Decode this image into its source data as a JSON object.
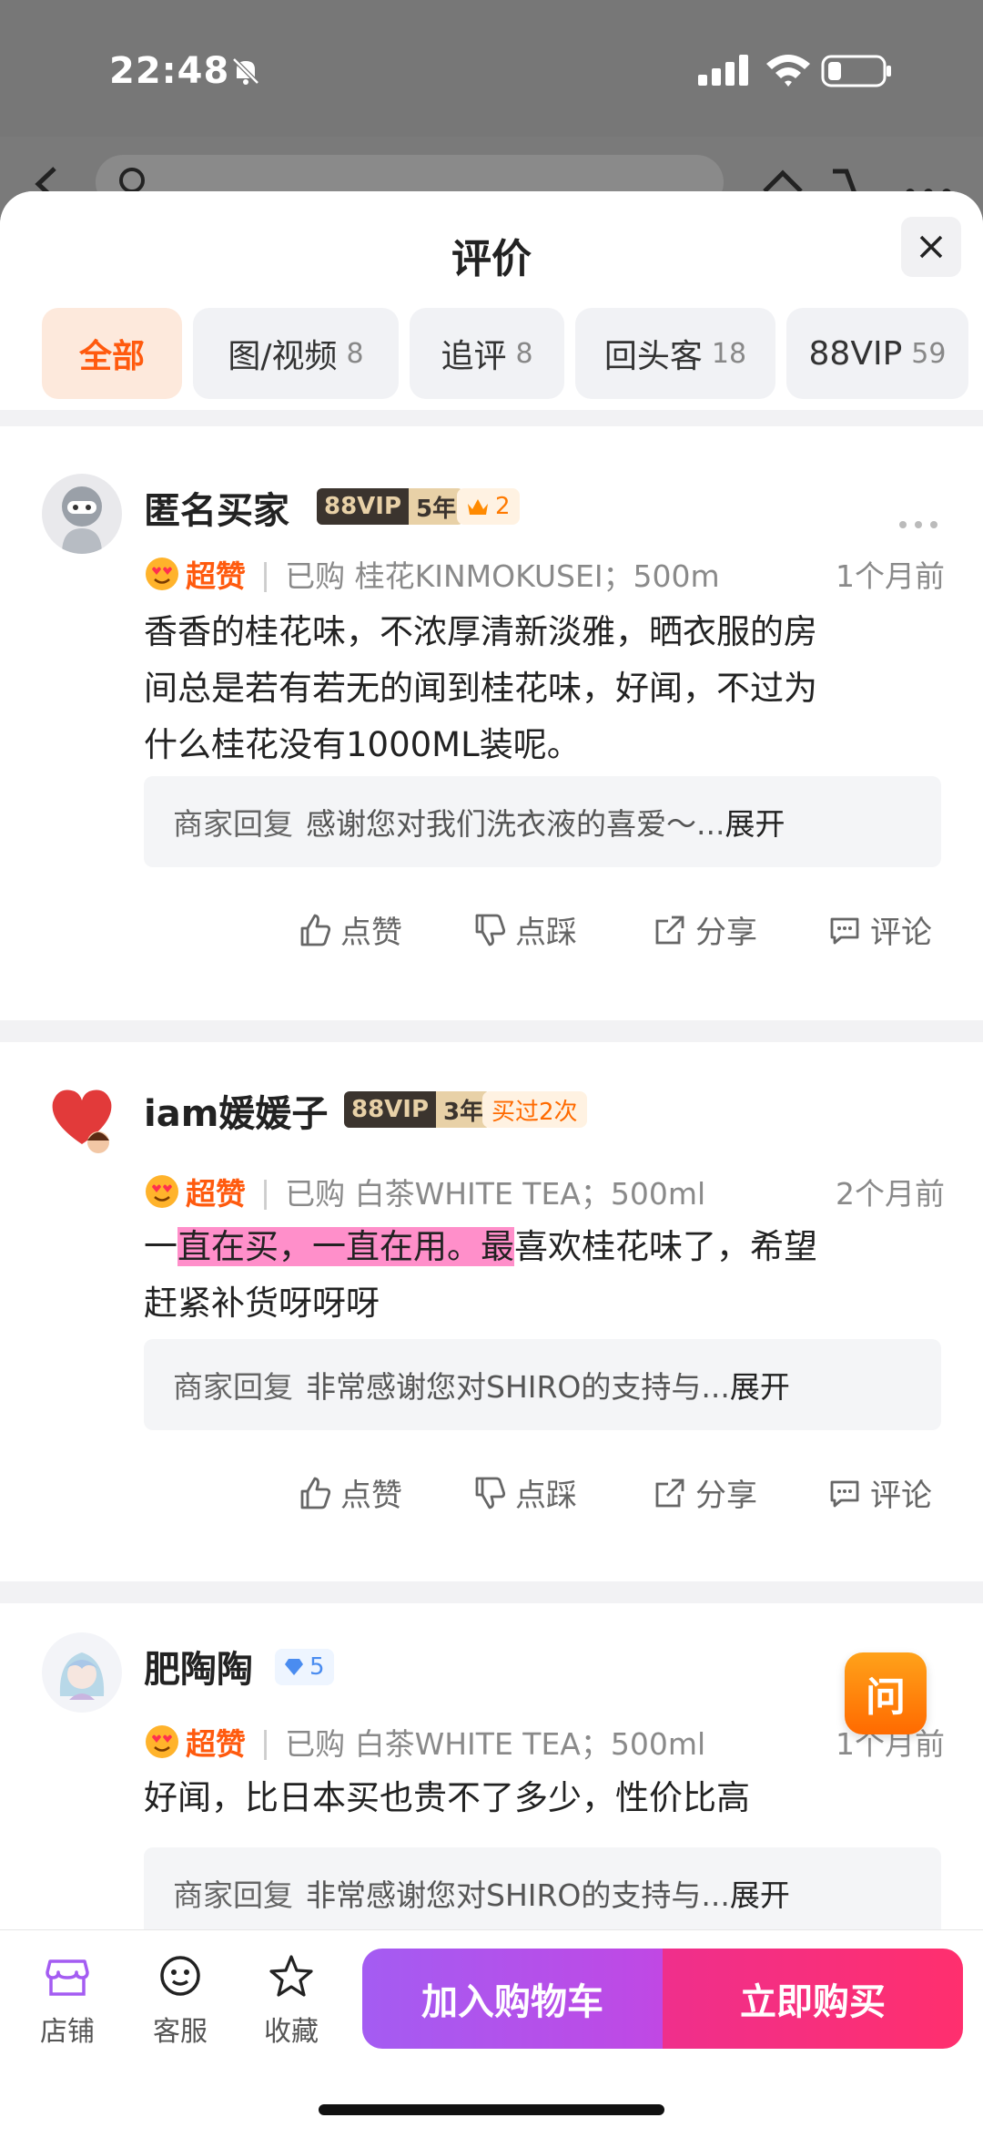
{
  "status_bar": {
    "time": "22:48"
  },
  "sheet": {
    "title": "评价",
    "tabs": [
      {
        "label": "全部",
        "count": ""
      },
      {
        "label": "图/视频",
        "count": "8"
      },
      {
        "label": "追评",
        "count": "8"
      },
      {
        "label": "回头客",
        "count": "18"
      },
      {
        "label": "88VIP",
        "count": "59"
      }
    ]
  },
  "reviews": [
    {
      "username": "匿名买家",
      "vip_label": "88VIP",
      "vip_years": "5年",
      "level": "2",
      "rating": "超赞",
      "purchase": "已购 桂花KINMOKUSEI；500m",
      "time": "1个月前",
      "content_lines": [
        "香香的桂花味，不浓厚清新淡雅，晒衣服的房",
        "间总是若有若无的闻到桂花味，好闻，不过为",
        "什么桂花没有1000ML装呢。"
      ],
      "reply_label": "商家回复",
      "reply_text": "感谢您对我们洗衣液的喜爱～...",
      "reply_expand": "展开"
    },
    {
      "username": "iam媛媛子",
      "vip_label": "88VIP",
      "vip_years": "3年",
      "repeat_badge": "买过2次",
      "rating": "超赞",
      "purchase": "已购 白茶WHITE TEA；500ml",
      "time": "2个月前",
      "content_pre": "一",
      "content_highlight": "直在买，一直在用。",
      "content_hl_end": "最",
      "content_rest": "喜欢桂花味了，希望",
      "content_line2": "赶紧补货呀呀呀",
      "reply_label": "商家回复",
      "reply_text": "非常感谢您对SHIRO的支持与...",
      "reply_expand": "展开"
    },
    {
      "username": "肥陶陶",
      "gem_level": "5",
      "rating": "超赞",
      "purchase": "已购 白茶WHITE TEA；500ml",
      "time": "1个月前",
      "content_lines": [
        "好闻，比日本买也贵不了多少，性价比高"
      ],
      "reply_label": "商家回复",
      "reply_text": "非常感谢您对SHIRO的支持与...",
      "reply_expand": "展开"
    }
  ],
  "actions": {
    "like": "点赞",
    "dislike": "点踩",
    "share": "分享",
    "comment": "评论"
  },
  "ask_button": "问",
  "bottom_bar": {
    "store": "店铺",
    "service": "客服",
    "favorite": "收藏",
    "add_to_cart": "加入购物车",
    "buy_now": "立即购买"
  },
  "colors": {
    "accent_orange": "#ff5a0e",
    "cart_purple": "#b052ec",
    "buy_pink": "#ff2f7a",
    "highlight_pink": "#ff8fca"
  }
}
